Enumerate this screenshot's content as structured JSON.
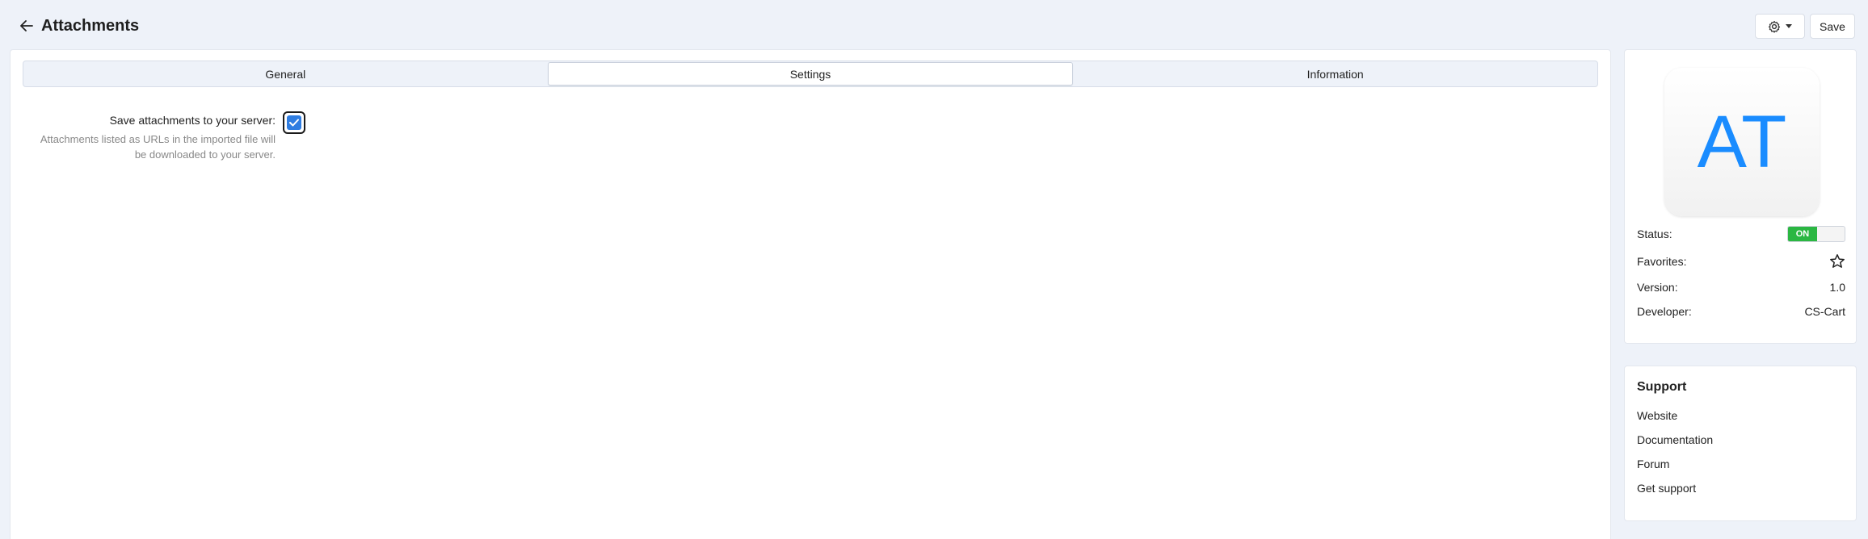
{
  "header": {
    "title": "Attachments",
    "save_label": "Save"
  },
  "tabs": [
    {
      "label": "General"
    },
    {
      "label": "Settings"
    },
    {
      "label": "Information"
    }
  ],
  "settings": {
    "save_attachments": {
      "label": "Save attachments to your server:",
      "help": "Attachments listed as URLs in the imported file will be downloaded to your server.",
      "checked": true
    }
  },
  "addon": {
    "logo_text": "AT",
    "status_label": "Status:",
    "status_value": "ON",
    "favorites_label": "Favorites:",
    "version_label": "Version:",
    "version_value": "1.0",
    "developer_label": "Developer:",
    "developer_value": "CS-Cart"
  },
  "support": {
    "title": "Support",
    "links": [
      "Website",
      "Documentation",
      "Forum",
      "Get support"
    ]
  },
  "icons": {
    "back": "arrow-left-icon",
    "settings": "gear-icon",
    "favorite": "star-icon"
  },
  "colors": {
    "accent": "#2f7de1",
    "status_on": "#2bb742",
    "logo_text": "#1a8cff",
    "background": "#eef2f9"
  }
}
